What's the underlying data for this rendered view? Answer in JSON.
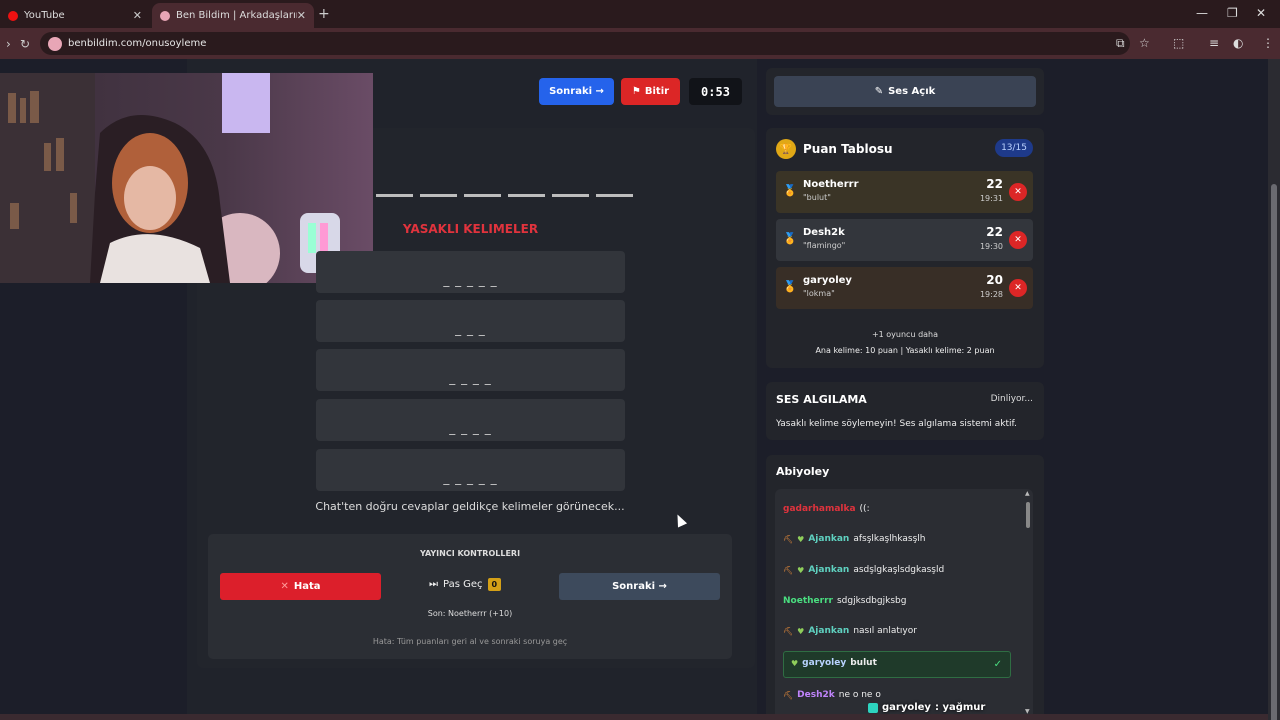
{
  "browser": {
    "tabs": [
      {
        "title": "YouTube",
        "close": "✕"
      },
      {
        "title": "Ben Bildim | Arkadaşlarınla",
        "close": "✕"
      }
    ],
    "new_tab": "+",
    "url": "benbildim.com/onusoyleme"
  },
  "game": {
    "next_label": "Sonraki →",
    "end_label": "Bitir",
    "timer": "0:53",
    "answer_dash_count": 6,
    "forbidden_title": "YASAKLI KELIMELER",
    "forbidden_words": [
      "_ _ _ _ _",
      "_ _ _",
      "_ _ _ _",
      "_ _ _ _",
      "_ _ _ _ _"
    ],
    "hint": "Chat'ten doğru cevaplar geldikçe kelimeler görünecek..."
  },
  "controls": {
    "title": "YAYINCI KONTROLLERI",
    "error_label": "Hata",
    "skip_label": "Pas Geç",
    "skip_count": "0",
    "next_label": "Sonraki →",
    "last": "Son: Noetherrr (+10)",
    "note": "Hata: Tüm puanları geri al ve sonraki soruya geç"
  },
  "sound_button": "Ses Açık",
  "leaderboard": {
    "title": "Puan Tablosu",
    "count": "13/15",
    "rows": [
      {
        "name": "Noetherrr",
        "word": "\"bulut\"",
        "score": "22",
        "time": "19:31"
      },
      {
        "name": "Desh2k",
        "word": "\"flamingo\"",
        "score": "22",
        "time": "19:30"
      },
      {
        "name": "garyoley",
        "word": "\"lokma\"",
        "score": "20",
        "time": "19:28"
      }
    ],
    "more": "+1 oyuncu daha",
    "rule": "Ana kelime: 10 puan | Yasaklı kelime: 2 puan"
  },
  "speech": {
    "title": "SES ALGILAMA",
    "status": "Dinliyor...",
    "desc": "Yasaklı kelime söylemeyin! Ses algılama sistemi aktif."
  },
  "chat": {
    "title": "Abiyoley",
    "messages": [
      {
        "user": "gadarhamalka",
        "text": "((:"
      },
      {
        "user": "Ajankan",
        "text": "afsşlkaşlhkasşlh"
      },
      {
        "user": "Ajankan",
        "text": "asdşlgkaşlsdgkasşld"
      },
      {
        "user": "Noetherrr",
        "text": "sdgjksdbgjksbg"
      },
      {
        "user": "Ajankan",
        "text": "nasıl anlatıyor"
      },
      {
        "user": "garyoley",
        "text": "bulut"
      },
      {
        "user": "Desh2k",
        "text": "ne o ne o"
      }
    ]
  },
  "overlay": {
    "user": "garyoley",
    "text": ": yağmur"
  },
  "colors": {
    "accent_blue": "#2563eb",
    "danger": "#dc2626",
    "forbidden": "#e0333d",
    "chat_user_red": "#e0333d",
    "chat_user_teal": "#5fd1c0",
    "chat_user_green": "#4ade80",
    "chat_user_purple": "#c084fc"
  }
}
